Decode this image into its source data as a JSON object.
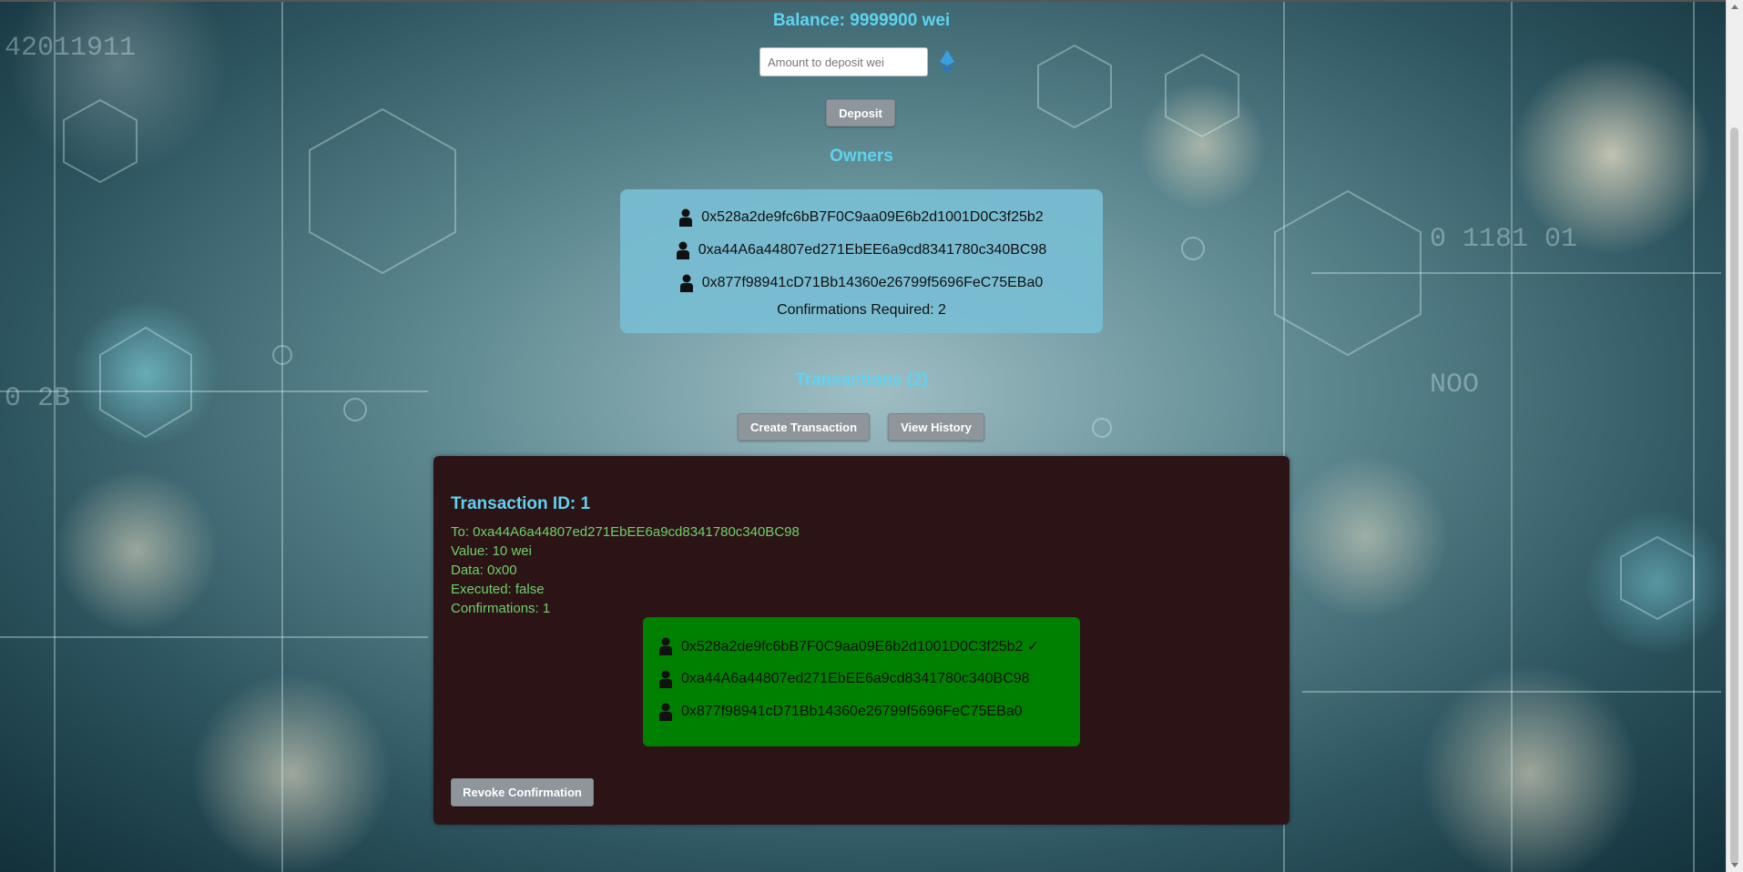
{
  "balance": {
    "text": "Balance: 9999900 wei"
  },
  "deposit": {
    "placeholder": "Amount to deposit wei",
    "value": "",
    "button_label": "Deposit",
    "icon": "ethereum-icon"
  },
  "owners": {
    "heading": "Owners",
    "addresses": [
      "0x528a2de9fc6bB7F0C9aa09E6b2d1001D0C3f25b2",
      "0xa44A6a44807ed271EbEE6a9cd8341780c340BC98",
      "0x877f98941cD71Bb14360e26799f5696FeC75EBa0"
    ],
    "confirmations_required": "Confirmations Required: 2"
  },
  "transactions": {
    "heading": "Transactions (2)",
    "create_label": "Create Transaction",
    "history_label": "View History",
    "items": [
      {
        "title": "Transaction ID: 1",
        "to": "To: 0xa44A6a44807ed271EbEE6a9cd8341780c340BC98",
        "value": "Value: 10 wei",
        "data": "Data: 0x00",
        "executed": "Executed: false",
        "confirmations": "Confirmations: 1",
        "owner_confirmations": [
          "0x528a2de9fc6bB7F0C9aa09E6b2d1001D0C3f25b2 ✓",
          "0xa44A6a44807ed271EbEE6a9cd8341780c340BC98",
          "0x877f98941cD71Bb14360e26799f5696FeC75EBa0"
        ],
        "revoke_label": "Revoke Confirmation"
      }
    ]
  },
  "colors": {
    "heading": "#5fd3f0",
    "owners_box": "#78bed4",
    "tx_panel": "#2c1416",
    "tx_text": "#6fcf6a",
    "confirm_box": "#008000",
    "button": "#8e969c"
  }
}
